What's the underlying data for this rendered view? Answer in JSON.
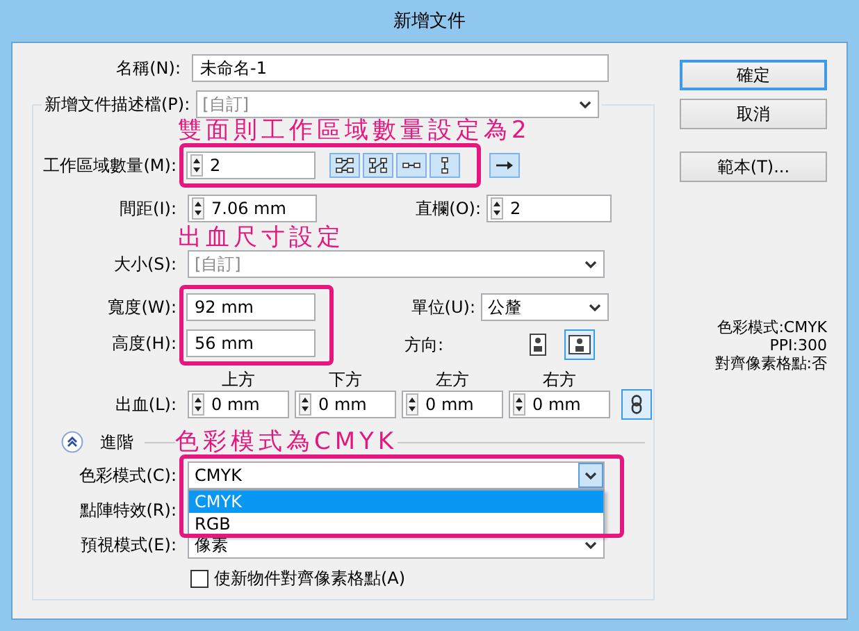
{
  "window": {
    "title": "新增文件"
  },
  "name": {
    "label": "名稱(N):",
    "value": "未命名-1"
  },
  "profile": {
    "label": "新增文件描述檔(P):",
    "value": "[自訂]",
    "disabled": true
  },
  "artboards": {
    "label": "工作區域數量(M):",
    "value": "2",
    "layouts": [
      {
        "kind": "grid-by-row"
      },
      {
        "kind": "grid-by-column"
      },
      {
        "kind": "arrange-by-row"
      },
      {
        "kind": "arrange-by-column"
      }
    ],
    "direction": {
      "kind": "left-to-right"
    }
  },
  "spacing": {
    "label": "間距(I):",
    "value": "7.06 mm"
  },
  "columns": {
    "label": "直欄(O):",
    "value": "2"
  },
  "size": {
    "label": "大小(S):",
    "value": "[自訂]",
    "disabled": true
  },
  "width": {
    "label": "寬度(W):",
    "value": "92 mm"
  },
  "height": {
    "label": "高度(H):",
    "value": "56 mm"
  },
  "units": {
    "label": "單位(U):",
    "value": "公釐",
    "disabled": false
  },
  "orientation": {
    "label": "方向:",
    "options": [
      {
        "kind": "portrait",
        "selected": false
      },
      {
        "kind": "landscape",
        "selected": true
      }
    ]
  },
  "bleed": {
    "label": "出血(L):",
    "linked": true,
    "sides": [
      {
        "heading": "上方",
        "value": "0 mm"
      },
      {
        "heading": "下方",
        "value": "0 mm"
      },
      {
        "heading": "左方",
        "value": "0 mm"
      },
      {
        "heading": "右方",
        "value": "0 mm"
      }
    ]
  },
  "advanced": {
    "label": "進階",
    "expanded": true
  },
  "color_mode": {
    "label": "色彩模式(C):",
    "value": "CMYK",
    "expanded": true,
    "options": [
      {
        "label": "CMYK",
        "selected": true
      },
      {
        "label": "RGB",
        "selected": false
      }
    ]
  },
  "raster_effects": {
    "label": "點陣特效(R):"
  },
  "preview_mode": {
    "label": "預視模式(E):",
    "value": "像素",
    "disabled": false
  },
  "align_to_pixel_grid": {
    "label": "使新物件對齊像素格點(A)",
    "checked": false
  },
  "buttons": [
    {
      "label": "確定",
      "default": true
    },
    {
      "label": "取消",
      "default": false
    },
    {
      "label": "範本(T)...",
      "default": false
    }
  ],
  "summary": [
    "色彩模式:CMYK",
    "PPI:300",
    "對齊像素格點:否"
  ],
  "annotations": [
    "雙面則工作區域數量設定為2",
    "出血尺寸設定",
    "色彩模式為CMYK"
  ]
}
